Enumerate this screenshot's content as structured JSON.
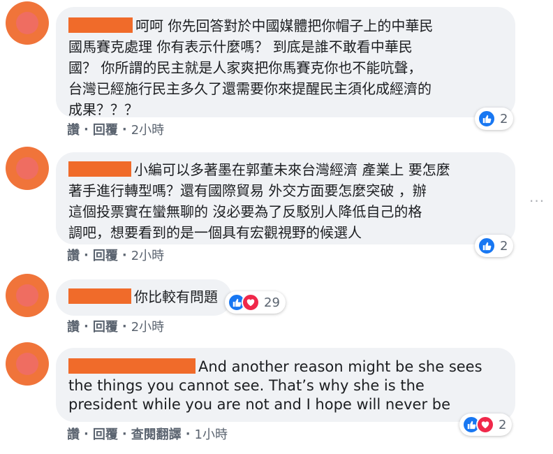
{
  "comments": [
    {
      "text": "呵呵 你先回答對於中國媒體把你帽子上的中華民\n國馬賽克處理 你有表示什麼嗎？ 到底是誰不敢看中華民\n國？ 你所謂的民主就是人家爽把你馬賽克你也不能吭聲，\n台灣已經施行民主多久了還需要你來提醒民主須化成經濟的\n成果？？？",
      "actions": [
        "讚",
        "回覆"
      ],
      "time": "2小時",
      "reaction_count": "2",
      "reaction_icons": [
        "like-icon"
      ]
    },
    {
      "text": "小編可以多著墨在郭董未來台灣經濟 產業上 要怎麼\n著手進行轉型嗎？還有國際貿易 外交方面要怎麼突破 ，辦\n這個投票實在蠻無聊的 沒必要為了反駁別人降低自己的格\n調吧，想要看到的是一個具有宏觀視野的候選人",
      "actions": [
        "讚",
        "回覆"
      ],
      "time": "2小時",
      "reaction_count": "2",
      "reaction_icons": [
        "like-icon"
      ]
    },
    {
      "text": "你比較有問題",
      "actions": [
        "讚",
        "回覆"
      ],
      "time": "2小時",
      "reaction_count": "29",
      "reaction_icons": [
        "like-icon",
        "love-icon"
      ]
    },
    {
      "text": "And another reason might be she sees\nthe things you cannot see. That’s why she is the\npresident while you are not and I hope will never be",
      "actions": [
        "讚",
        "回覆",
        "查閱翻譯"
      ],
      "time": "1小時",
      "reaction_count": "2",
      "reaction_icons": [
        "like-icon",
        "love-icon"
      ]
    }
  ],
  "more_icon": "more-options-icon",
  "colors": {
    "like": "#1877f2",
    "love": "#f0284a",
    "bubble": "#f0f2f5",
    "redaction": "#f06b2a"
  }
}
